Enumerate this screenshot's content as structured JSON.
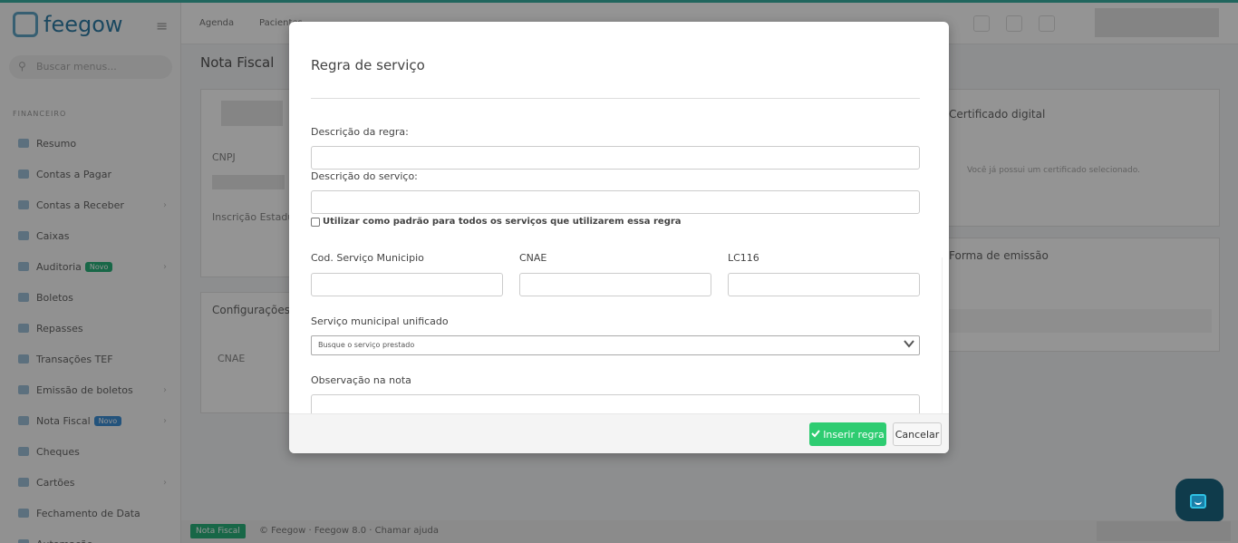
{
  "app": {
    "logo_text": "feegow"
  },
  "sidebar": {
    "search_placeholder": "Buscar menus...",
    "section_label": "FINANCEIRO",
    "items": [
      {
        "label": "Resumo",
        "badge": ""
      },
      {
        "label": "Contas a Pagar",
        "badge": ""
      },
      {
        "label": "Contas a Receber",
        "badge": ""
      },
      {
        "label": "Caixas",
        "badge": ""
      },
      {
        "label": "Auditoria",
        "badge": "Novo"
      },
      {
        "label": "Boletos",
        "badge": ""
      },
      {
        "label": "Repasses",
        "badge": ""
      },
      {
        "label": "Transações TEF",
        "badge": ""
      },
      {
        "label": "Emissão de boletos",
        "badge": ""
      },
      {
        "label": "Nota Fiscal",
        "badge": "Novo"
      },
      {
        "label": "Cheques",
        "badge": ""
      },
      {
        "label": "Cartões",
        "badge": ""
      },
      {
        "label": "Fechamento de Data",
        "badge": ""
      },
      {
        "label": "Automação",
        "badge": ""
      }
    ]
  },
  "topbar": {
    "items": [
      "Agenda",
      "Pacientes"
    ]
  },
  "page": {
    "breadcrumb": "Nota Fiscal",
    "card1_field1": "CNPJ",
    "card1_field2": "Inscrição Estadual",
    "card2_title": "Configurações",
    "card2_col": "CNAE",
    "right_card1_title": "Certificado digital",
    "right_card1_text": "Você já possui um certificado selecionado.",
    "right_card2_title": "Forma de emissão"
  },
  "footer": {
    "badge": "Nota Fiscal",
    "text": "© Feegow · Feegow 8.0 · Chamar ajuda"
  },
  "modal": {
    "title": "Regra de serviço",
    "descricao_regra_label": "Descrição da regra:",
    "descricao_regra_value": "",
    "descricao_servico_label": "Descrição do serviço:",
    "descricao_servico_value": "",
    "padrao_checkbox_label": "Utilizar como padrão para todos os serviços que utilizarem essa regra",
    "padrao_checked": false,
    "cod_servico_label": "Cod. Serviço Municipio",
    "cod_servico_value": "",
    "cnae_label": "CNAE",
    "cnae_value": "",
    "lc116_label": "LC116",
    "lc116_value": "",
    "servico_unificado_label": "Serviço municipal unificado",
    "servico_unificado_placeholder": "Busque o serviço prestado",
    "observacao_label": "Observação na nota",
    "observacao_value": "",
    "insert_button": "Inserir regra",
    "cancel_button": "Cancelar"
  },
  "colors": {
    "primary_button": "#2ecc71",
    "chat_widget": "#0f3b4b",
    "chat_accent": "#2ec1e3"
  },
  "icons": {
    "confirm": "check-icon",
    "select": "chevron-down-icon",
    "chat": "chat-icon"
  }
}
